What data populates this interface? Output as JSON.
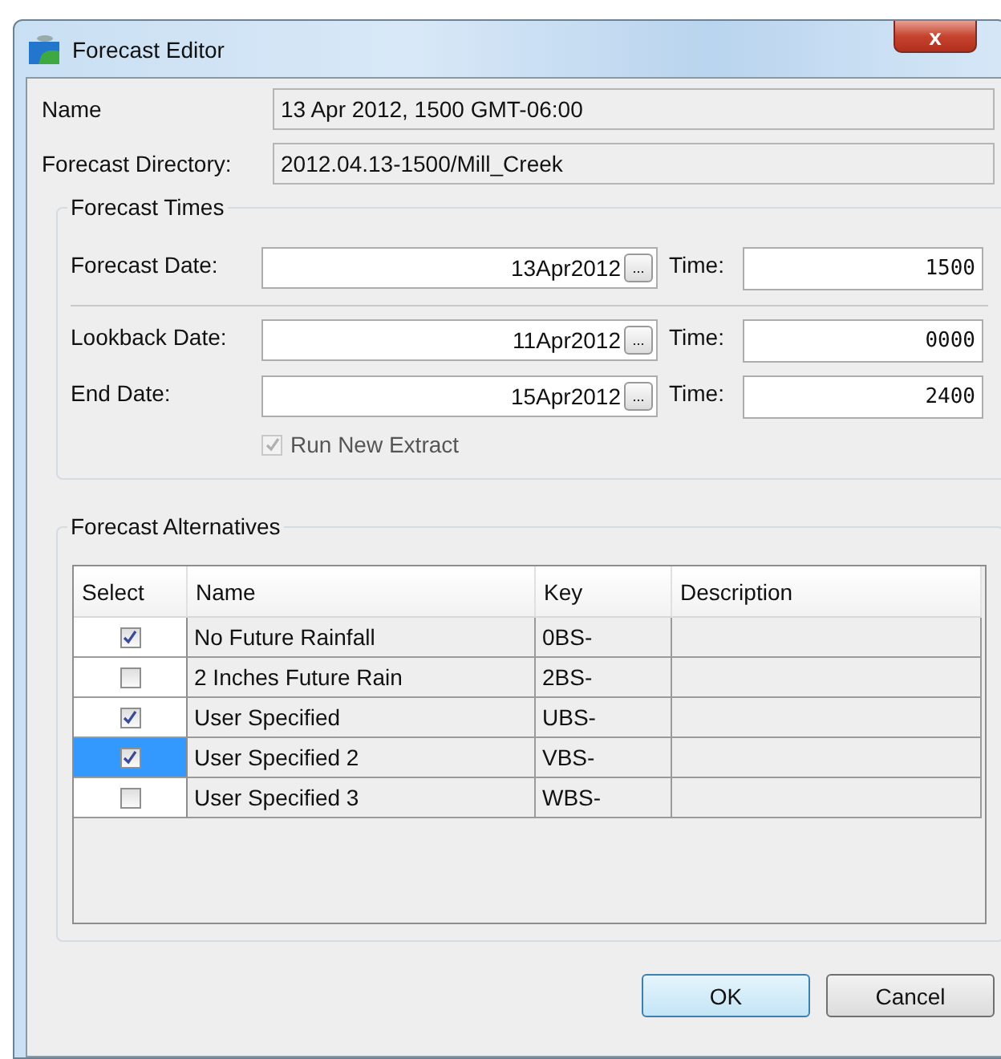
{
  "window": {
    "title": "Forecast Editor",
    "close": "x"
  },
  "info": [
    {
      "label": "Name",
      "value": "13 Apr 2012, 1500 GMT-06:00"
    },
    {
      "label": "Forecast Directory:",
      "value": "2012.04.13-1500/Mill_Creek"
    }
  ],
  "forecast_times": {
    "title": "Forecast Times",
    "rows": [
      {
        "label": "Forecast Date:",
        "date": "13Apr2012",
        "browse": "...",
        "time_label": "Time:",
        "time": "1500"
      },
      {
        "label": "Lookback Date:",
        "date": "11Apr2012",
        "browse": "...",
        "time_label": "Time:",
        "time": "0000"
      },
      {
        "label": "End Date:",
        "date": "15Apr2012",
        "browse": "...",
        "time_label": "Time:",
        "time": "2400"
      }
    ],
    "run_new_extract": {
      "label": "Run New Extract",
      "checked": true,
      "disabled": true
    }
  },
  "alternatives": {
    "title": "Forecast Alternatives",
    "columns": [
      "Select",
      "Name",
      "Key",
      "Description"
    ],
    "rows": [
      {
        "checked": true,
        "selected": false,
        "name": "No Future Rainfall",
        "key": "0BS-"
      },
      {
        "checked": false,
        "selected": false,
        "name": "2 Inches Future Rain",
        "key": "2BS-"
      },
      {
        "checked": true,
        "selected": false,
        "name": "User Specified",
        "key": "UBS-"
      },
      {
        "checked": true,
        "selected": true,
        "name": "User Specified 2",
        "key": "VBS-"
      },
      {
        "checked": false,
        "selected": false,
        "name": "User Specified 3",
        "key": "WBS-"
      }
    ]
  },
  "buttons": [
    {
      "label": "OK",
      "default": true
    },
    {
      "label": "Cancel",
      "default": false
    }
  ]
}
